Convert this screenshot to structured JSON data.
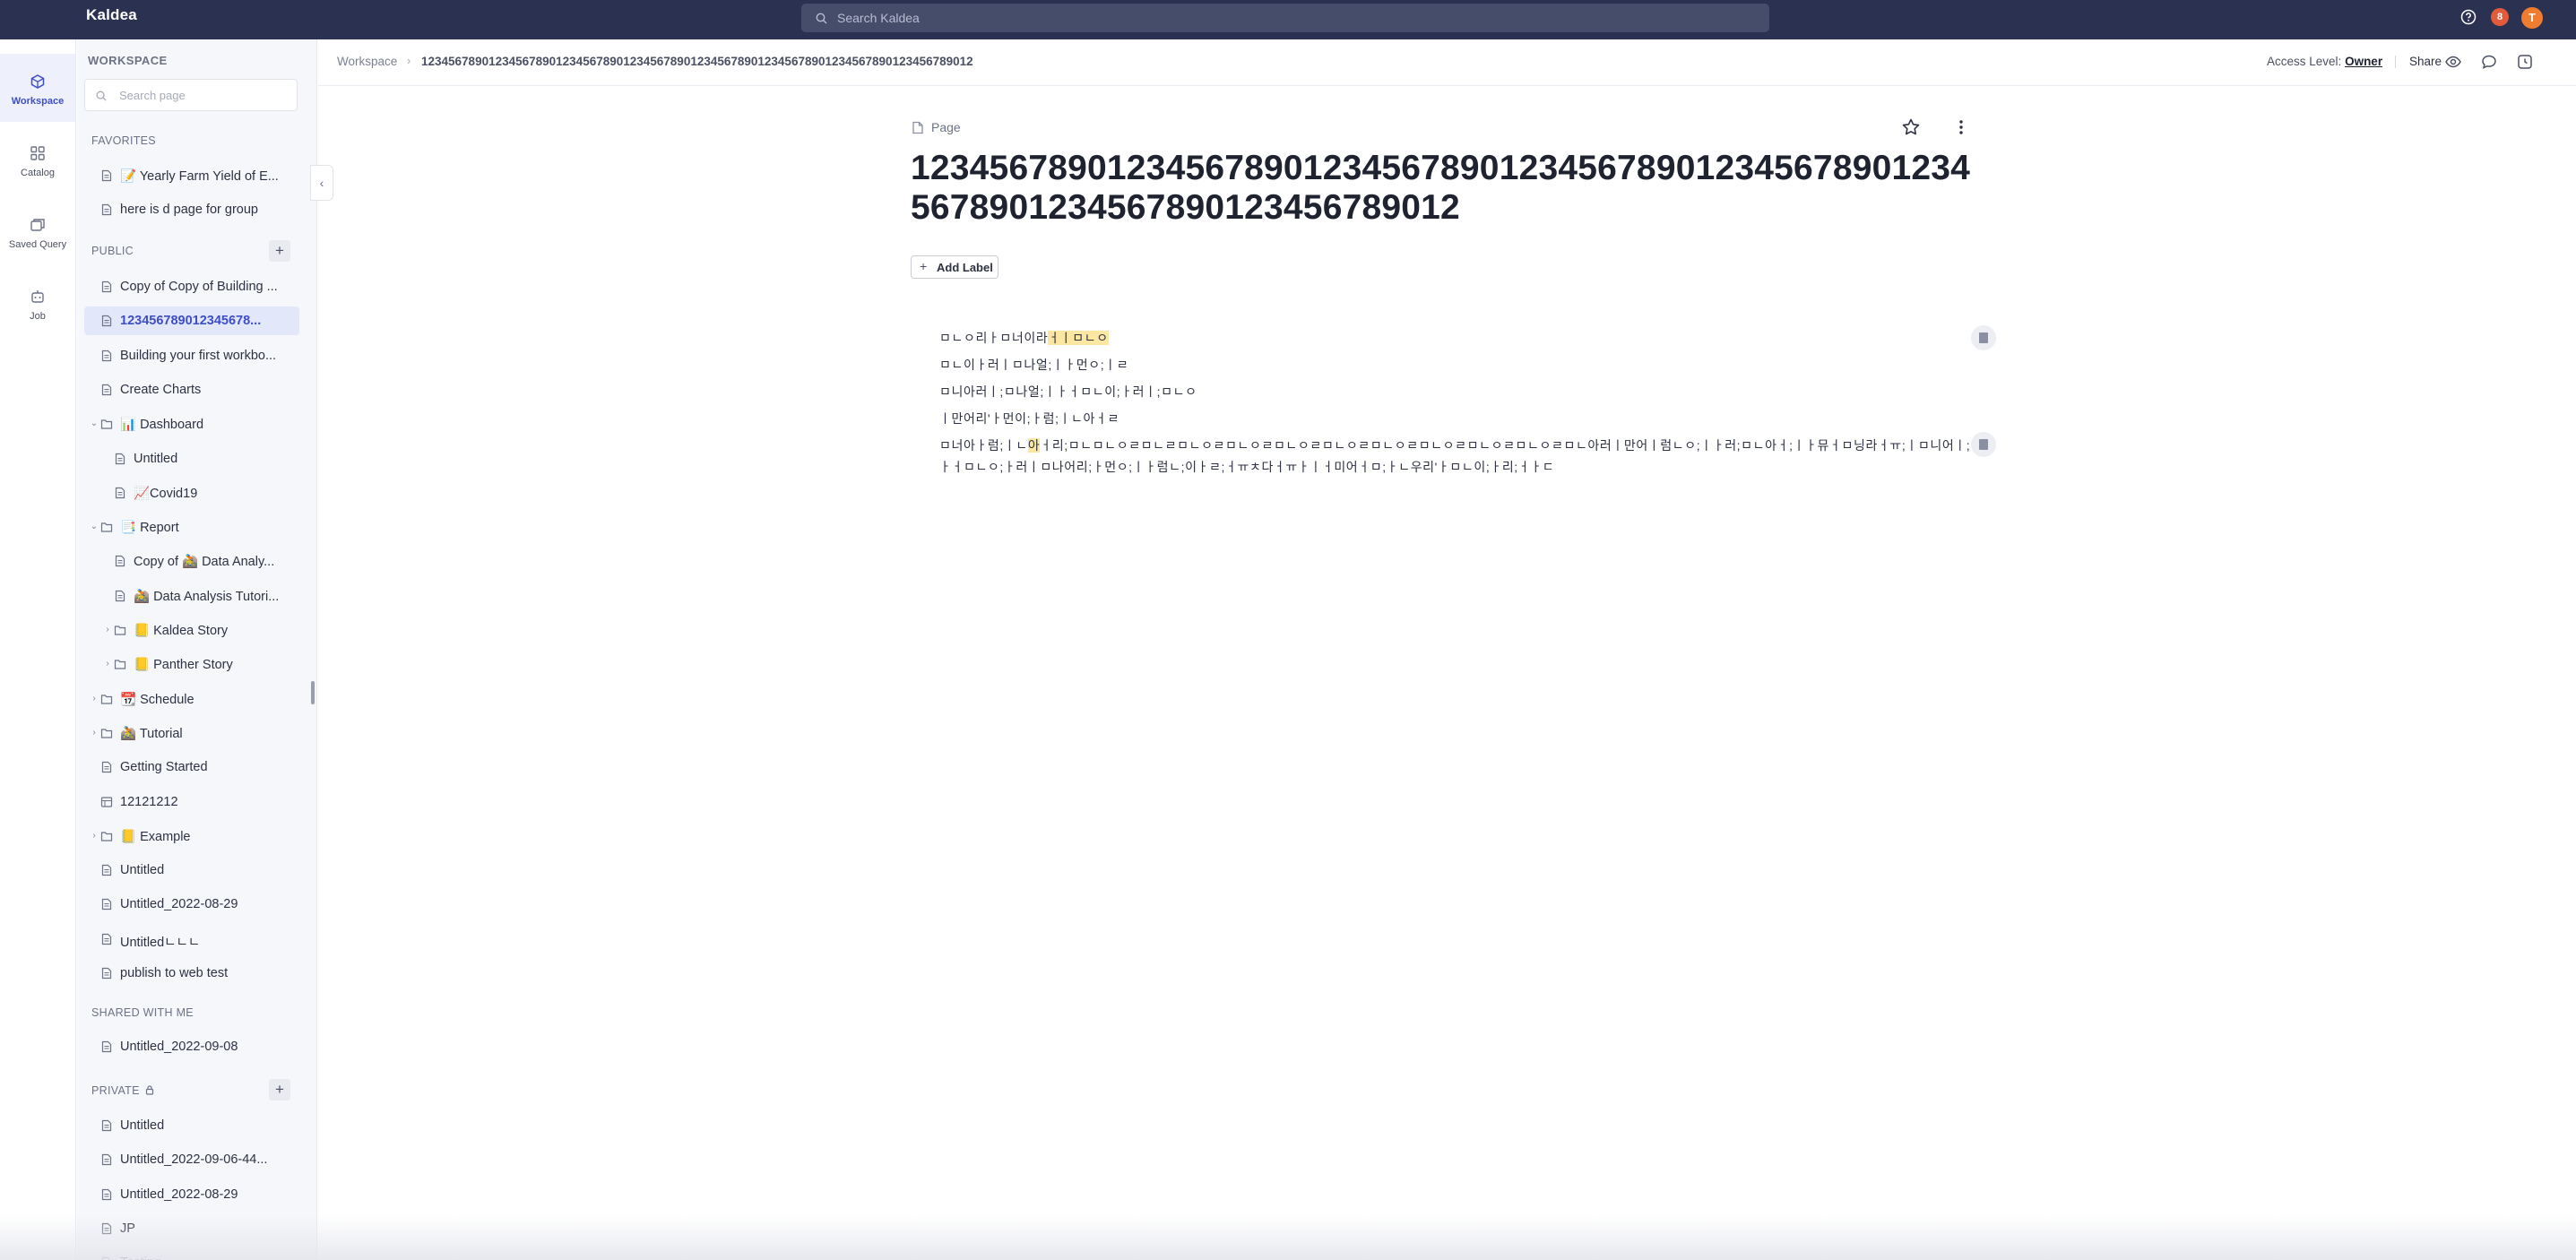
{
  "app": {
    "name": "Kaldea",
    "search_placeholder": "Search Kaldea",
    "notification_count": "8",
    "avatar_initial": "T"
  },
  "rail": [
    {
      "label": "Workspace",
      "icon": "workspace-icon",
      "active": true
    },
    {
      "label": "Catalog",
      "icon": "catalog-icon",
      "active": false
    },
    {
      "label": "Saved Query",
      "icon": "saved-query-icon",
      "active": false
    },
    {
      "label": "Job",
      "icon": "job-icon",
      "active": false
    }
  ],
  "sidebar": {
    "title": "WORKSPACE",
    "search_placeholder": "Search page",
    "favorites_label": "FAVORITES",
    "public_label": "PUBLIC",
    "shared_label": "SHARED WITH ME",
    "private_label": "PRIVATE",
    "favorites": [
      {
        "label": "📝 Yearly Farm Yield of E..."
      },
      {
        "label": "here is d page for group"
      }
    ],
    "public": [
      {
        "label": "Copy of Copy of Building ...",
        "depth": 0,
        "type": "page"
      },
      {
        "label": "123456789012345678...",
        "depth": 0,
        "type": "page",
        "selected": true
      },
      {
        "label": "Building your first workbo...",
        "depth": 0,
        "type": "page"
      },
      {
        "label": "Create Charts",
        "depth": 0,
        "type": "page"
      },
      {
        "label": "📊 Dashboard",
        "depth": 0,
        "type": "folder",
        "expanded": true
      },
      {
        "label": "Untitled",
        "depth": 1,
        "type": "page"
      },
      {
        "label": "📈Covid19",
        "depth": 1,
        "type": "page"
      },
      {
        "label": "📑 Report",
        "depth": 0,
        "type": "folder",
        "expanded": true
      },
      {
        "label": "Copy of 🚵 Data Analy...",
        "depth": 1,
        "type": "page"
      },
      {
        "label": "🚵 Data Analysis Tutori...",
        "depth": 1,
        "type": "page"
      },
      {
        "label": "📒 Kaldea Story",
        "depth": 1,
        "type": "folder",
        "expanded": false
      },
      {
        "label": "📒 Panther Story",
        "depth": 1,
        "type": "folder",
        "expanded": false
      },
      {
        "label": "📆 Schedule",
        "depth": 0,
        "type": "folder",
        "expanded": false
      },
      {
        "label": "🚵 Tutorial",
        "depth": 0,
        "type": "folder",
        "expanded": false
      },
      {
        "label": "Getting Started",
        "depth": 0,
        "type": "page"
      },
      {
        "label": "12121212",
        "depth": 0,
        "type": "query"
      },
      {
        "label": "📒 Example",
        "depth": 0,
        "type": "folder",
        "expanded": false
      },
      {
        "label": "Untitled",
        "depth": 0,
        "type": "page"
      },
      {
        "label": "Untitled_2022-08-29",
        "depth": 0,
        "type": "page"
      },
      {
        "label": "Untitledㄴㄴㄴ",
        "depth": 0,
        "type": "page"
      },
      {
        "label": "publish to web test",
        "depth": 0,
        "type": "page"
      }
    ],
    "shared": [
      {
        "label": "Untitled_2022-09-08"
      }
    ],
    "private": [
      {
        "label": "Untitled"
      },
      {
        "label": "Untitled_2022-09-06-44..."
      },
      {
        "label": "Untitled_2022-08-29"
      },
      {
        "label": "JP"
      },
      {
        "label": "Testing"
      }
    ]
  },
  "header": {
    "breadcrumb_root": "Workspace",
    "breadcrumb_page": "1234567890123456789012345678901234567890123456789012345678901234567890123456789012",
    "access_label": "Access Level:",
    "access_value": "Owner",
    "share_label": "Share"
  },
  "page": {
    "type_label": "Page",
    "title": "1234567890123456789012345678901234567890123456789012345678901234567890123456789012",
    "add_label": "Add Label",
    "paragraphs": [
      {
        "before": "ㅁㄴㅇ리ㅏㅁ너이라",
        "highlight": "ㅓㅣㅁㄴㅇ",
        "after": ""
      },
      {
        "before": "ㅁㄴ이ㅏ러ㅣㅁ나얼;ㅣㅏ먼ㅇ;ㅣㄹ",
        "highlight": "",
        "after": ""
      },
      {
        "before": "ㅁ니아러ㅣ;ㅁ나얼;ㅣㅏㅓㅁㄴ이;ㅏ러ㅣ;ㅁㄴㅇ",
        "highlight": "",
        "after": ""
      },
      {
        "before": "ㅣ만어리'ㅏ먼이;ㅏ럼;ㅣㄴ아ㅓㄹ",
        "highlight": "",
        "after": ""
      },
      {
        "before": "ㅁ너아ㅏ럼;ㅣㄴ",
        "highlight": "아",
        "after": "ㅓ리;ㅁㄴㅁㄴㅇㄹㅁㄴㄹㅁㄴㅇㄹㅁㄴㅇㄹㅁㄴㅇㄹㅁㄴㅇㄹㅁㄴㅇㄹㅁㄴㅇㄹㅁㄴㅇㄹㅁㄴㅇㄹㅁㄴ아러ㅣ만어ㅣ럼ㄴㅇ;ㅣㅏ러;ㅁㄴ아ㅓ;ㅣㅏ뮤ㅓㅁ닝라ㅓㅠ;ㅣㅁ니어ㅣ;"
      },
      {
        "before": "ㅏㅓㅁㄴㅇ;ㅏ러ㅣㅁ나어리;ㅏ먼ㅇ;ㅣㅏ럼ㄴ;이ㅏㄹ;ㅓㅠㅊ다ㅓㅠㅏㅣㅓ미어ㅓㅁ;ㅏㄴ우리'ㅏㅁㄴ이;ㅏ리;ㅓㅏㄷ",
        "highlight": "",
        "after": ""
      }
    ]
  }
}
